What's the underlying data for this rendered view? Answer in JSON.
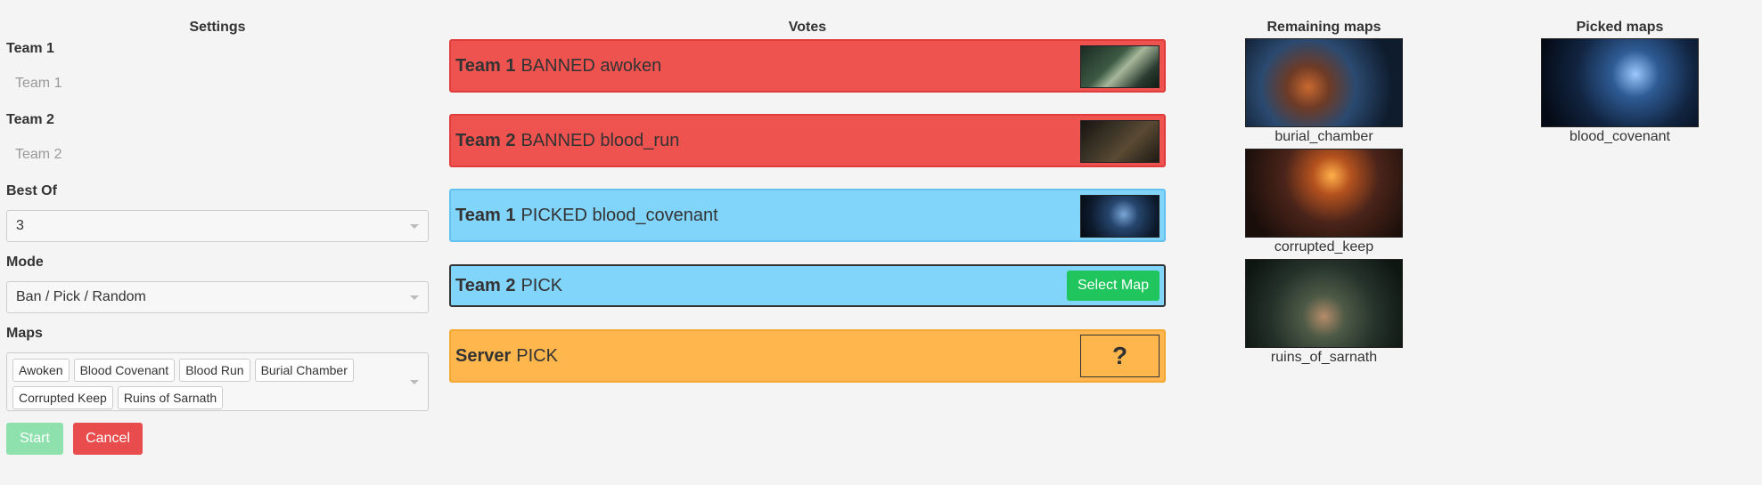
{
  "settings": {
    "title": "Settings",
    "team1_label": "Team 1",
    "team1_placeholder": "Team 1",
    "team2_label": "Team 2",
    "team2_placeholder": "Team 2",
    "bestof_label": "Best Of",
    "bestof_value": "3",
    "mode_label": "Mode",
    "mode_value": "Ban / Pick / Random",
    "maps_label": "Maps",
    "maps": [
      "Awoken",
      "Blood Covenant",
      "Blood Run",
      "Burial Chamber",
      "Corrupted Keep",
      "Ruins of Sarnath"
    ],
    "start_label": "Start",
    "cancel_label": "Cancel"
  },
  "votes": {
    "title": "Votes",
    "items": [
      {
        "team": "Team 1",
        "action": "BANNED awoken"
      },
      {
        "team": "Team 2",
        "action": "BANNED blood_run"
      },
      {
        "team": "Team 1",
        "action": "PICKED blood_covenant"
      },
      {
        "team": "Team 2",
        "action": "PICK"
      },
      {
        "team": "Server",
        "action": "PICK"
      }
    ],
    "select_map_label": "Select Map",
    "unknown_symbol": "?"
  },
  "remaining": {
    "title": "Remaining maps",
    "maps": [
      "burial_chamber",
      "corrupted_keep",
      "ruins_of_sarnath"
    ]
  },
  "picked": {
    "title": "Picked maps",
    "maps": [
      "blood_covenant"
    ]
  },
  "colors": {
    "banned": "#ef5350",
    "picked": "#81d4fa",
    "server": "#ffb74d",
    "select_map": "#21c55d",
    "cancel": "#e84c4c",
    "start": "#8ee0ad"
  }
}
